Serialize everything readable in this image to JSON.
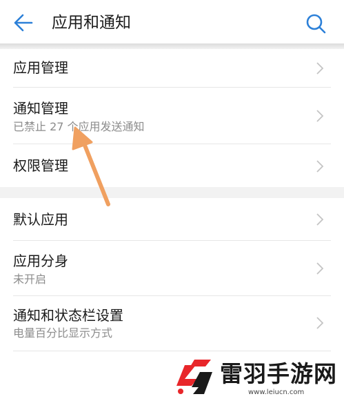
{
  "header": {
    "title": "应用和通知",
    "back_icon": "arrow-left-icon",
    "search_icon": "search-icon",
    "accent_color": "#2c80d8"
  },
  "group1": {
    "items": [
      {
        "title": "应用管理"
      },
      {
        "title": "通知管理",
        "subtitle": "已禁止 27 个应用发送通知"
      },
      {
        "title": "权限管理"
      }
    ]
  },
  "group2": {
    "items": [
      {
        "title": "默认应用"
      },
      {
        "title": "应用分身",
        "subtitle": "未开启"
      },
      {
        "title": "通知和状态栏设置",
        "subtitle": "电量百分比显示方式"
      }
    ]
  },
  "annotation": {
    "arrow_color": "#f0a060"
  },
  "watermark": {
    "name": "雷羽手游网",
    "url": "www.leiucn.com",
    "icon": "leiyu-logo-icon",
    "logo_colors": [
      "#e8262a",
      "#1a1a1a"
    ]
  }
}
